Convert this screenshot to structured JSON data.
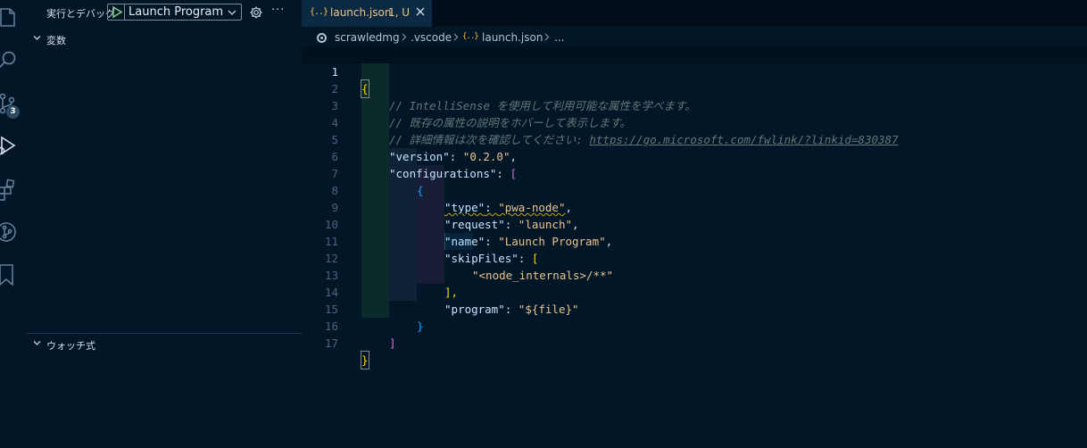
{
  "colors": {
    "background": "#011627",
    "accent_string": "#ecc48d",
    "comment": "#637777",
    "brace_level1": "#ffd700",
    "brace_level2": "#da70d6",
    "brace_level3": "#179fff",
    "warning_squiggle": "#cca700",
    "play_green": "#89d185"
  },
  "activity_bar": {
    "items": [
      {
        "icon": "files-icon",
        "active": false
      },
      {
        "icon": "search-icon",
        "active": false
      },
      {
        "icon": "source-control-icon",
        "active": false,
        "badge": "3"
      },
      {
        "icon": "run-debug-icon",
        "active": true
      },
      {
        "icon": "extensions-icon",
        "active": false
      },
      {
        "icon": "git-graph-icon",
        "active": false
      },
      {
        "icon": "bookmark-icon",
        "active": false
      }
    ]
  },
  "sidebar": {
    "title": "実行とデバッグ",
    "launch_config": "Launch Program (",
    "more": "···",
    "sections": {
      "variables": "変数",
      "watch": "ウォッチ式"
    }
  },
  "editor": {
    "tab": {
      "icon": "{..}",
      "name": "launch.json",
      "status": "1, U"
    },
    "breadcrumb": {
      "root": "scrawledmg",
      "folder": ".vscode",
      "file_icon": "{..}",
      "file": "launch.json",
      "tail": "..."
    },
    "current_line": 1,
    "lines": [
      {
        "n": "1",
        "text": "{"
      },
      {
        "n": "2",
        "text": "// IntelliSense を使用して利用可能な属性を学べます。"
      },
      {
        "n": "3",
        "text": "// 既存の属性の説明をホバーして表示します。"
      },
      {
        "n": "4",
        "comment_prefix": "// 詳細情報は次を確認してください: ",
        "link": "https://go.microsoft.com/fwlink/?linkid=830387"
      },
      {
        "n": "5",
        "key": "\"version\"",
        "value": "\"0.2.0\""
      },
      {
        "n": "6",
        "key": "\"configurations\"",
        "value": "["
      },
      {
        "n": "7",
        "text": "{"
      },
      {
        "n": "8",
        "key": "\"type\"",
        "value": "\"pwa-node\""
      },
      {
        "n": "9",
        "key": "\"request\"",
        "value": "\"launch\""
      },
      {
        "n": "10",
        "key": "\"name\"",
        "value": "\"Launch Program\""
      },
      {
        "n": "11",
        "key": "\"skipFiles\"",
        "value": "["
      },
      {
        "n": "12",
        "value": "\"<node_internals>/**\""
      },
      {
        "n": "13",
        "text": "],"
      },
      {
        "n": "14",
        "key": "\"program\"",
        "value": "\"${file}\""
      },
      {
        "n": "15",
        "text": "}"
      },
      {
        "n": "16",
        "text": "]"
      },
      {
        "n": "17",
        "text": "}"
      }
    ]
  }
}
